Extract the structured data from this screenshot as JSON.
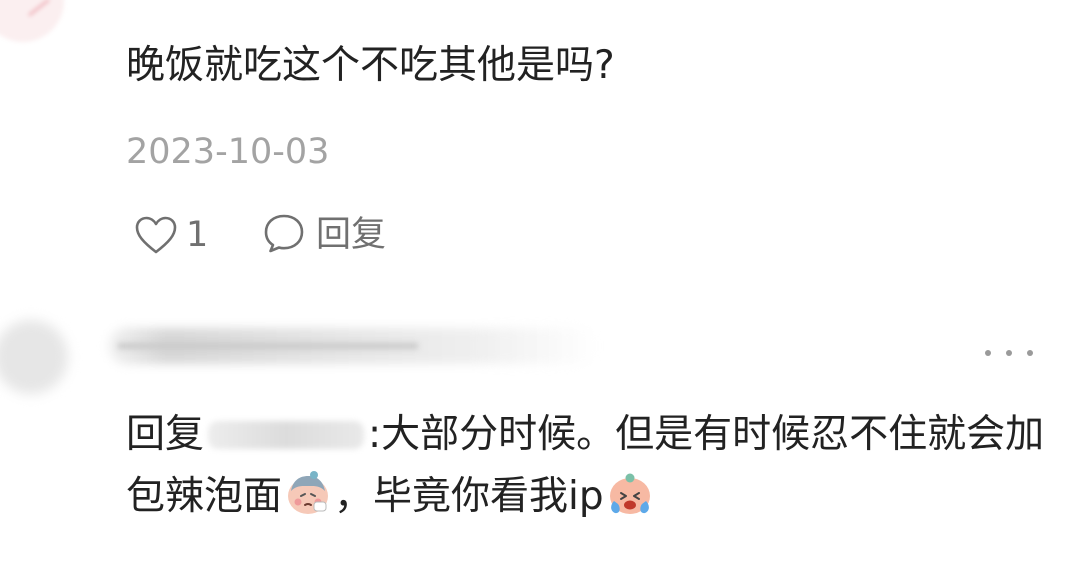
{
  "comment": {
    "text": "晚饭就吃这个不吃其他是吗?",
    "date": "2023-10-03",
    "like_count": "1",
    "reply_label": "回复"
  },
  "reply": {
    "prefix": "回复",
    "separator": ":",
    "text_part1": "大部分时候。但是有时候忍不住就会加包辣泡面",
    "text_part2": "，毕竟你看我ip",
    "emoji_1": "sick-face-emoji",
    "emoji_2": "crying-face-emoji"
  },
  "icons": {
    "like": "heart-icon",
    "reply": "comment-bubble-icon",
    "more": "more-dots-icon"
  }
}
